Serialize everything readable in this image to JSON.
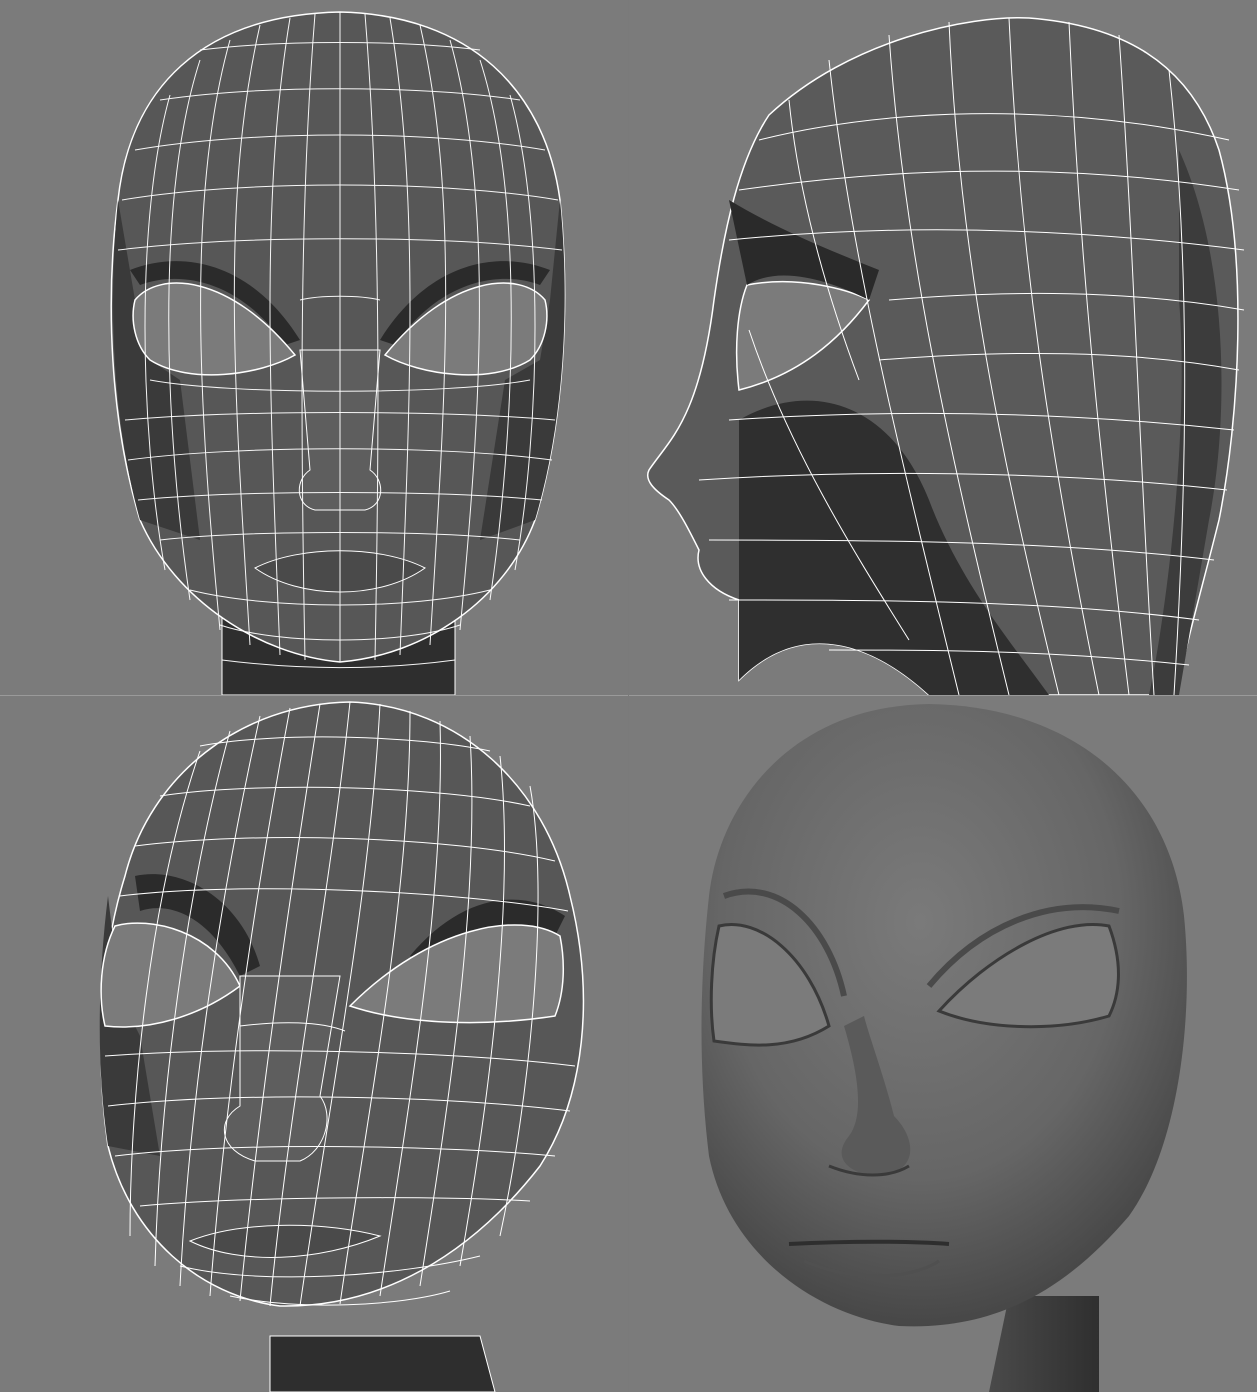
{
  "viewports": [
    {
      "id": "front",
      "shading": "wireframe-on-shaded"
    },
    {
      "id": "side",
      "shading": "wireframe-on-shaded"
    },
    {
      "id": "perspective",
      "shading": "wireframe-on-shaded"
    },
    {
      "id": "render",
      "shading": "smooth-shaded"
    }
  ],
  "colors": {
    "background": "#7b7b7b",
    "mesh_dark": "#3a3a3a",
    "mesh_mid": "#5a5a5a",
    "wire": "#ffffff",
    "render_skin": "#6e6e6e"
  }
}
